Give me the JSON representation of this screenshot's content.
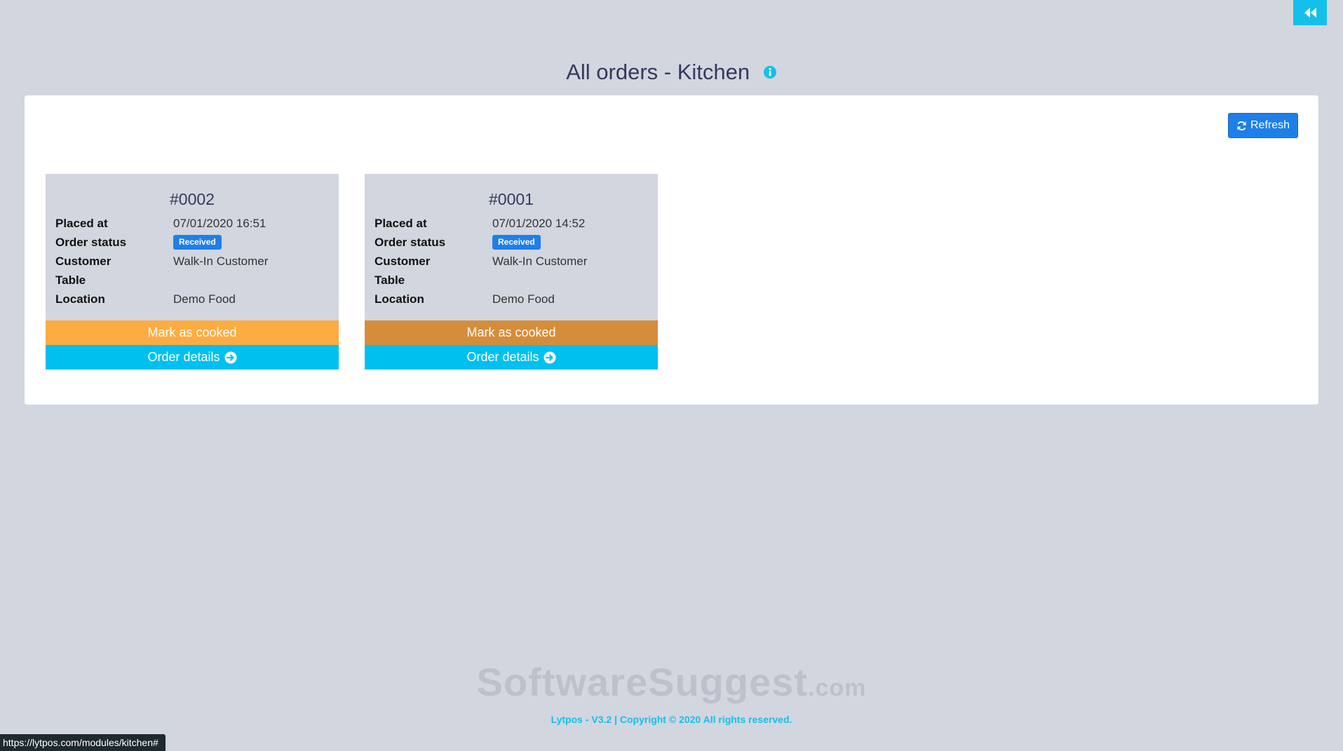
{
  "page": {
    "title": "All orders - Kitchen"
  },
  "toolbar": {
    "refresh_label": "Refresh"
  },
  "labels": {
    "placed_at": "Placed at",
    "order_status": "Order status",
    "customer": "Customer",
    "table": "Table",
    "location": "Location"
  },
  "orders": [
    {
      "number": "#0002",
      "placed_at": "07/01/2020 16:51",
      "status": "Received",
      "customer": "Walk-In Customer",
      "table": "",
      "location": "Demo Food",
      "cook_label": "Mark as cooked",
      "details_label": "Order details"
    },
    {
      "number": "#0001",
      "placed_at": "07/01/2020 14:52",
      "status": "Received",
      "customer": "Walk-In Customer",
      "table": "",
      "location": "Demo Food",
      "cook_label": "Mark as cooked",
      "details_label": "Order details"
    }
  ],
  "watermark": {
    "main": "SoftwareSuggest",
    "suffix": ".com"
  },
  "footer": {
    "text": "Lytpos - V3.2 | Copyright © 2020 All rights reserved."
  },
  "status_bar": {
    "url": "https://lytpos.com/modules/kitchen#"
  },
  "colors": {
    "accent": "#14c0e9",
    "primary": "#1f7fe8",
    "cook": "#fdac41",
    "cook_hover": "#d68d3a",
    "details": "#00c0ef",
    "background": "#d2d6df"
  },
  "icons": {
    "back": "double-chevron-left-icon",
    "info": "info-circle-icon",
    "refresh": "refresh-icon",
    "details": "arrow-circle-right-icon"
  }
}
